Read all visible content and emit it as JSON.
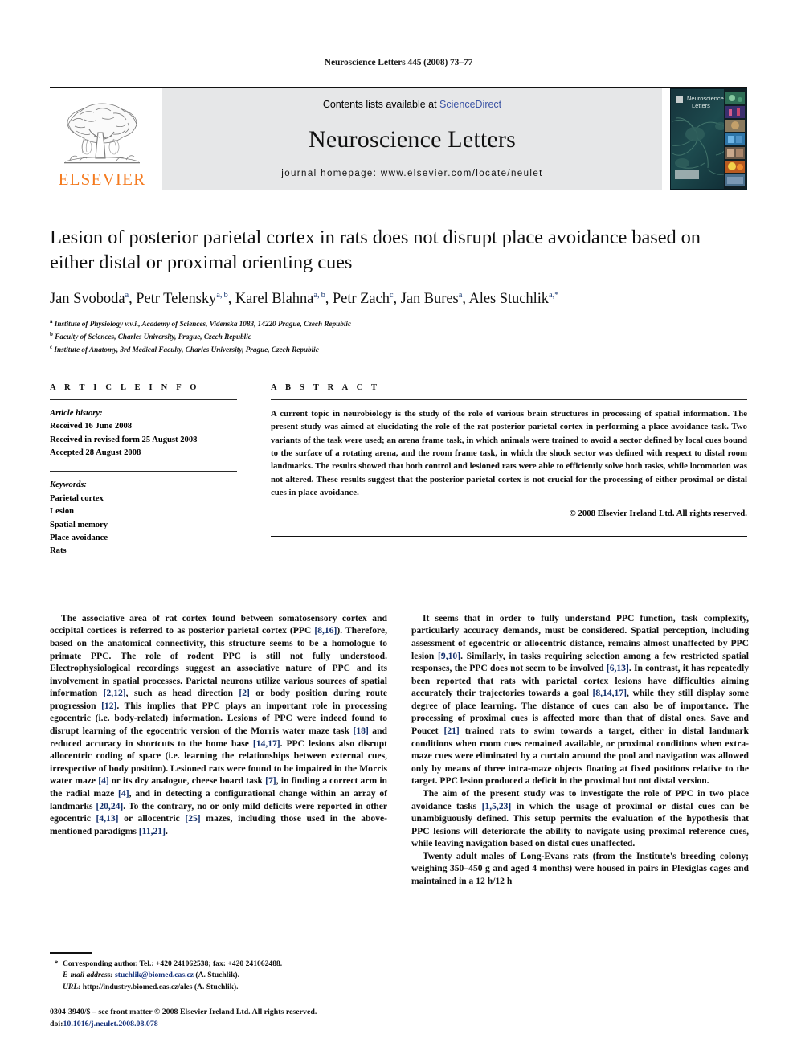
{
  "running_head": "Neuroscience Letters 445 (2008) 73–77",
  "masthead": {
    "publisher_name": "ELSEVIER",
    "contents_prefix": "Contents lists available at ",
    "contents_link": "ScienceDirect",
    "journal_title": "Neuroscience Letters",
    "homepage": "journal homepage: www.elsevier.com/locate/neulet",
    "cover_title_line1": "Neuroscience",
    "cover_title_line2": "Letters",
    "link_color": "#3a53a4",
    "brand_color": "#F47B20"
  },
  "article": {
    "title": "Lesion of posterior parietal cortex in rats does not disrupt place avoidance based on either distal or proximal orienting cues",
    "authors_html": "Jan Svoboda<sup>a</sup>, Petr Telensky<sup>a, b</sup>, Karel Blahna<sup>a, b</sup>, Petr Zach<sup>c</sup>, Jan Bures<sup>a</sup>, Ales Stuchlik<sup>a,</sup><sup class=\"star\">*</sup>",
    "affiliations": [
      {
        "mark": "a",
        "text": "Institute of Physiology v.v.i., Academy of Sciences, Videnska 1083, 14220 Prague, Czech Republic"
      },
      {
        "mark": "b",
        "text": "Faculty of Sciences, Charles University, Prague, Czech Republic"
      },
      {
        "mark": "c",
        "text": "Institute of Anatomy, 3rd Medical Faculty, Charles University, Prague, Czech Republic"
      }
    ]
  },
  "info": {
    "heading": "A R T I C L E    I N F O",
    "history_label": "Article history:",
    "history": [
      "Received 16 June 2008",
      "Received in revised form 25 August 2008",
      "Accepted 28 August 2008"
    ],
    "keywords_label": "Keywords:",
    "keywords": [
      "Parietal cortex",
      "Lesion",
      "Spatial memory",
      "Place avoidance",
      "Rats"
    ]
  },
  "abstract": {
    "heading": "A B S T R A C T",
    "text": "A current topic in neurobiology is the study of the role of various brain structures in processing of spatial information. The present study was aimed at elucidating the role of the rat posterior parietal cortex in performing a place avoidance task. Two variants of the task were used; an arena frame task, in which animals were trained to avoid a sector defined by local cues bound to the surface of a rotating arena, and the room frame task, in which the shock sector was defined with respect to distal room landmarks. The results showed that both control and lesioned rats were able to efficiently solve both tasks, while locomotion was not altered. These results suggest that the posterior parietal cortex is not crucial for the processing of either proximal or distal cues in place avoidance.",
    "copyright": "© 2008 Elsevier Ireland Ltd. All rights reserved."
  },
  "body": {
    "left_paragraphs": [
      "The associative area of rat cortex found between somatosensory cortex and occipital cortices is referred to as posterior parietal cortex (PPC <span class=\"ref\">[8,16]</span>). Therefore, based on the anatomical connectivity, this structure seems to be a homologue to primate PPC. The role of rodent PPC is still not fully understood. Electrophysiological recordings suggest an associative nature of PPC and its involvement in spatial processes. Parietal neurons utilize various sources of spatial information <span class=\"ref\">[2,12]</span>, such as head direction <span class=\"ref\">[2]</span> or body position during route progression <span class=\"ref\">[12]</span>. This implies that PPC plays an important role in processing egocentric (i.e. body-related) information. Lesions of PPC were indeed found to disrupt learning of the egocentric version of the Morris water maze task <span class=\"ref\">[18]</span> and reduced accuracy in shortcuts to the home base <span class=\"ref\">[14,17]</span>. PPC lesions also disrupt allocentric coding of space (i.e. learning the relationships between external cues, irrespective of body position). Lesioned rats were found to be impaired in the Morris water maze <span class=\"ref\">[4]</span> or its dry analogue, cheese board task <span class=\"ref\">[7]</span>, in finding a correct arm in the radial maze <span class=\"ref\">[4]</span>, and in detecting a configurational change within an array of landmarks <span class=\"ref\">[20,24]</span>. To the contrary, no or only mild deficits were reported in other egocentric <span class=\"ref\">[4,13]</span> or allocentric <span class=\"ref\">[25]</span> mazes, including those used in the above-mentioned paradigms <span class=\"ref\">[11,21]</span>."
    ],
    "right_paragraphs": [
      "It seems that in order to fully understand PPC function, task complexity, particularly accuracy demands, must be considered. Spatial perception, including assessment of egocentric or allocentric distance, remains almost unaffected by PPC lesion <span class=\"ref\">[9,10]</span>. Similarly, in tasks requiring selection among a few restricted spatial responses, the PPC does not seem to be involved <span class=\"ref\">[6,13]</span>. In contrast, it has repeatedly been reported that rats with parietal cortex lesions have difficulties aiming accurately their trajectories towards a goal <span class=\"ref\">[8,14,17]</span>, while they still display some degree of place learning. The distance of cues can also be of importance. The processing of proximal cues is affected more than that of distal ones. Save and Poucet <span class=\"ref\">[21]</span> trained rats to swim towards a target, either in distal landmark conditions when room cues remained available, or proximal conditions when extra-maze cues were eliminated by a curtain around the pool and navigation was allowed only by means of three intra-maze objects floating at fixed positions relative to the target. PPC lesion produced a deficit in the proximal but not distal version.",
      "The aim of the present study was to investigate the role of PPC in two place avoidance tasks <span class=\"ref\">[1,5,23]</span> in which the usage of proximal or distal cues can be unambiguously defined. This setup permits the evaluation of the hypothesis that PPC lesions will deteriorate the ability to navigate using proximal reference cues, while leaving navigation based on distal cues unaffected.",
      "Twenty adult males of Long-Evans rats (from the Institute's breeding colony; weighing 350–450 g and aged 4 months) were housed in pairs in Plexiglas cages and maintained in a 12 h/12 h"
    ]
  },
  "footnotes": {
    "star": "*",
    "corresponding": "Corresponding author. Tel.: +420 241062538; fax: +420 241062488.",
    "email_label": "E-mail address:",
    "email": "stuchlik@biomed.cas.cz",
    "email_suffix": " (A. Stuchlik).",
    "url_label": "URL:",
    "url": "http://industry.biomed.cas.cz/ales",
    "url_suffix": " (A. Stuchlik).",
    "imprint": "0304-3940/$ – see front matter © 2008 Elsevier Ireland Ltd. All rights reserved.",
    "doi_label": "doi:",
    "doi": "10.1016/j.neulet.2008.08.078"
  }
}
